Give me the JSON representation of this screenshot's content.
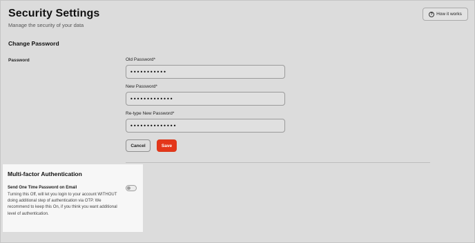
{
  "header": {
    "title": "Security Settings",
    "subtitle": "Manage the security of your data",
    "help_button_label": "How it works",
    "help_icon_glyph": "?"
  },
  "change_password": {
    "section_title": "Change Password",
    "group_label": "Password",
    "fields": [
      {
        "label": "Old Password*",
        "value": "•••••••••••"
      },
      {
        "label": "New Password*",
        "value": "•••••••••••••"
      },
      {
        "label": "Re-type New Password*",
        "value": "••••••••••••••"
      }
    ],
    "cancel_label": "Cancel",
    "save_label": "Save"
  },
  "mfa": {
    "section_title": "Multi-factor Authentication",
    "option_title": "Send One Time Password on Email",
    "option_description": "Turning this Off, will let you login to your account WITHOUT doing additional step of authentication via OTP. We recommend to keep this On, if you think you want additional level of authentication.",
    "toggle_on": false
  },
  "colors": {
    "accent": "#e4361a",
    "background": "#dcdcdc",
    "panel": "#f7f7f7"
  }
}
